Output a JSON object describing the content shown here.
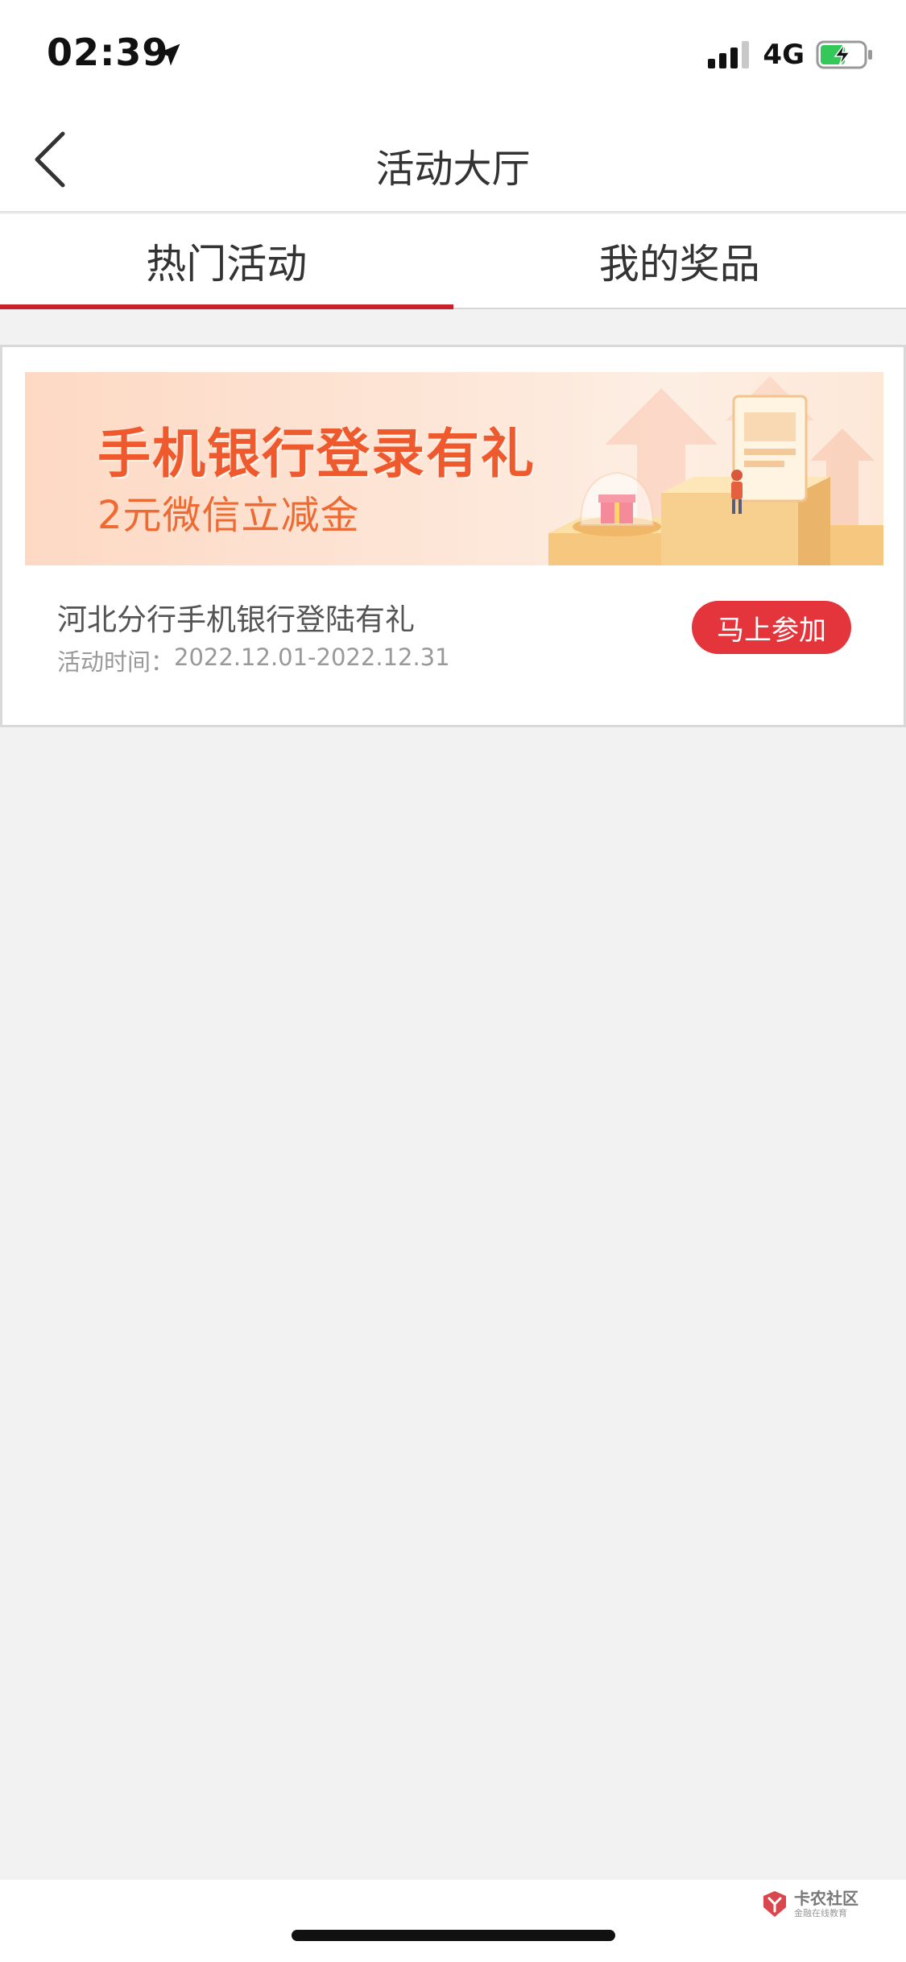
{
  "status_bar": {
    "time": "02:39",
    "network": "4G"
  },
  "nav": {
    "title": "活动大厅"
  },
  "tabs": [
    {
      "label": "热门活动",
      "active": true
    },
    {
      "label": "我的奖品",
      "active": false
    }
  ],
  "activity": {
    "banner_title": "手机银行登录有礼",
    "banner_subtitle": "2元微信立减金",
    "name": "河北分行手机银行登陆有礼",
    "time_label": "活动时间：",
    "time_range": "2022.12.01-2022.12.31",
    "join_label": "马上参加"
  },
  "watermark": {
    "title": "卡农社区",
    "subtitle": "金融在线教育"
  },
  "colors": {
    "accent_red": "#c8202c",
    "button_red": "#e3353b",
    "banner_orange": "#ee5a2e",
    "background": "#f2f2f2"
  },
  "icons": {
    "back": "chevron-left-icon",
    "location": "location-arrow-icon",
    "signal": "signal-bars-icon",
    "battery": "battery-charging-icon"
  }
}
